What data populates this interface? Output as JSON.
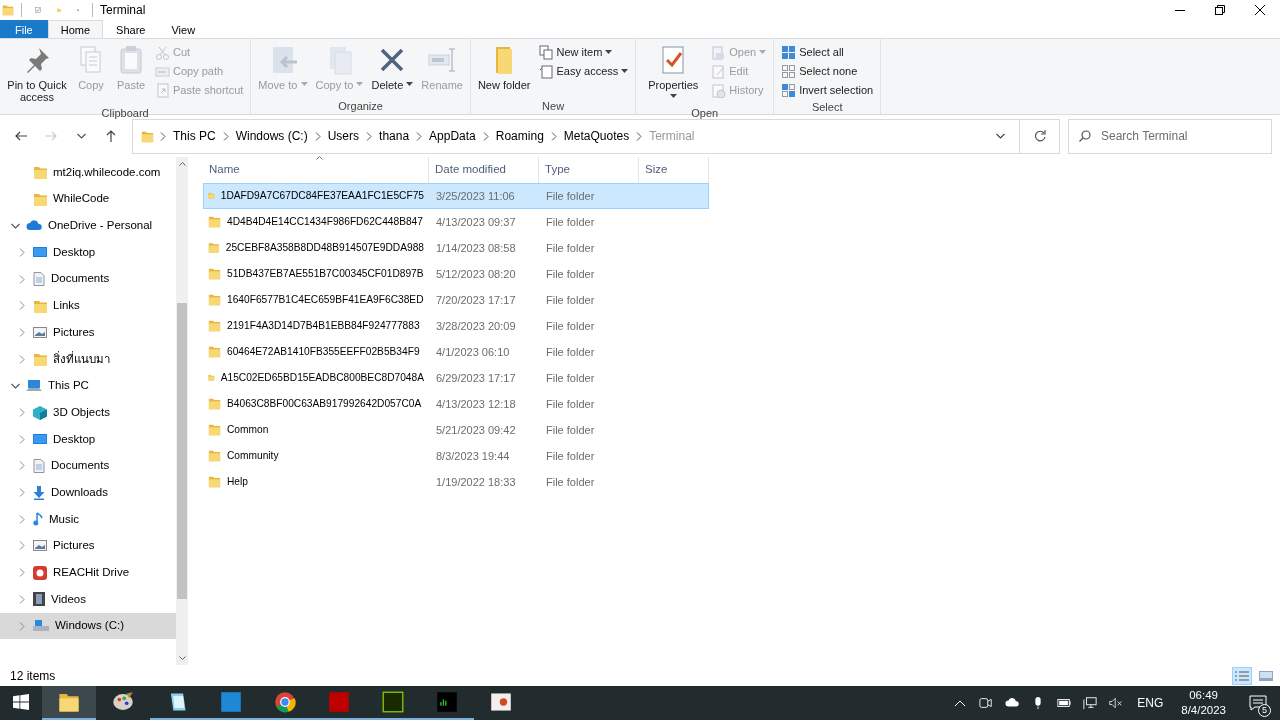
{
  "window": {
    "title": "Terminal"
  },
  "ribbon_tabs": [
    {
      "label": "File",
      "kind": "file",
      "selected": false
    },
    {
      "label": "Home",
      "kind": "tab",
      "selected": true
    },
    {
      "label": "Share",
      "kind": "tab",
      "selected": false
    },
    {
      "label": "View",
      "kind": "tab",
      "selected": false
    }
  ],
  "ribbon_groups": [
    {
      "label": "Clipboard",
      "commands": [
        {
          "label": "Pin to Quick access",
          "kind": "large",
          "disabled": false,
          "dropdown": false
        },
        {
          "label": "Copy",
          "kind": "large",
          "disabled": true,
          "dropdown": false
        },
        {
          "label": "Paste",
          "kind": "large",
          "disabled": true,
          "dropdown": false
        },
        {
          "label": "Cut",
          "kind": "small",
          "disabled": true,
          "dropdown": false
        },
        {
          "label": "Copy path",
          "kind": "small",
          "disabled": true,
          "dropdown": false
        },
        {
          "label": "Paste shortcut",
          "kind": "small",
          "disabled": true,
          "dropdown": false
        }
      ]
    },
    {
      "label": "Organize",
      "commands": [
        {
          "label": "Move to",
          "kind": "large",
          "disabled": true,
          "dropdown": true
        },
        {
          "label": "Copy to",
          "kind": "large",
          "disabled": true,
          "dropdown": true
        },
        {
          "label": "Delete",
          "kind": "large",
          "disabled": false,
          "dropdown": true
        },
        {
          "label": "Rename",
          "kind": "large",
          "disabled": true,
          "dropdown": false
        }
      ]
    },
    {
      "label": "New",
      "commands": [
        {
          "label": "New folder",
          "kind": "large",
          "disabled": false,
          "dropdown": false
        },
        {
          "label": "New item",
          "kind": "small",
          "disabled": false,
          "dropdown": true
        },
        {
          "label": "Easy access",
          "kind": "small",
          "disabled": false,
          "dropdown": true
        }
      ]
    },
    {
      "label": "Open",
      "commands": [
        {
          "label": "Properties",
          "kind": "large",
          "disabled": false,
          "dropdown": true
        },
        {
          "label": "Open",
          "kind": "small",
          "disabled": true,
          "dropdown": true
        },
        {
          "label": "Edit",
          "kind": "small",
          "disabled": true,
          "dropdown": false
        },
        {
          "label": "History",
          "kind": "small",
          "disabled": true,
          "dropdown": false
        }
      ]
    },
    {
      "label": "Select",
      "commands": [
        {
          "label": "Select all",
          "kind": "small",
          "disabled": false,
          "dropdown": false
        },
        {
          "label": "Select none",
          "kind": "small",
          "disabled": false,
          "dropdown": false
        },
        {
          "label": "Invert selection",
          "kind": "small",
          "disabled": false,
          "dropdown": false
        }
      ]
    }
  ],
  "navigation": {
    "back_disabled": false,
    "forward_disabled": true,
    "up_disabled": false
  },
  "address": {
    "crumbs": [
      "This PC",
      "Windows (C:)",
      "Users",
      "thana",
      "AppData",
      "Roaming",
      "MetaQuotes",
      "Terminal"
    ],
    "search_placeholder": "Search Terminal"
  },
  "nav_pane": {
    "continued_items": [
      {
        "label": "mt2iq.whilecode.com",
        "selected": false
      },
      {
        "label": "WhileCode",
        "selected": false
      }
    ],
    "roots": [
      {
        "label": "OneDrive - Personal",
        "expanded": true,
        "selected": false,
        "children": [
          {
            "label": "Desktop",
            "expanded": false,
            "selected": false
          },
          {
            "label": "Documents",
            "expanded": false,
            "selected": false
          },
          {
            "label": "Links",
            "expanded": false,
            "selected": false
          },
          {
            "label": "Pictures",
            "expanded": false,
            "selected": false
          },
          {
            "label": "สิ่งที่แนบมา",
            "expanded": false,
            "selected": false
          }
        ]
      },
      {
        "label": "This PC",
        "expanded": true,
        "selected": false,
        "children": [
          {
            "label": "3D Objects",
            "expanded": false,
            "selected": false
          },
          {
            "label": "Desktop",
            "expanded": false,
            "selected": false
          },
          {
            "label": "Documents",
            "expanded": false,
            "selected": false
          },
          {
            "label": "Downloads",
            "expanded": false,
            "selected": false
          },
          {
            "label": "Music",
            "expanded": false,
            "selected": false
          },
          {
            "label": "Pictures",
            "expanded": false,
            "selected": false
          },
          {
            "label": "REACHit Drive",
            "expanded": false,
            "selected": false
          },
          {
            "label": "Videos",
            "expanded": false,
            "selected": false
          },
          {
            "label": "Windows (C:)",
            "expanded": false,
            "selected": true
          }
        ]
      }
    ]
  },
  "table": {
    "columns": [
      {
        "label": "Name",
        "sorted": true
      },
      {
        "label": "Date modified",
        "sorted": false
      },
      {
        "label": "Type",
        "sorted": false
      },
      {
        "label": "Size",
        "sorted": false
      }
    ],
    "rows": [
      {
        "name": "1DAFD9A7C67DC84FE37EAA1FC1E5CF75",
        "date": "3/25/2023 11:06",
        "type": "File folder",
        "selected": true
      },
      {
        "name": "4D4B4D4E14CC1434F986FD62C448B847",
        "date": "4/13/2023 09:37",
        "type": "File folder",
        "selected": false
      },
      {
        "name": "25CEBF8A358B8DD48B914507E9DDA988",
        "date": "1/14/2023 08:58",
        "type": "File folder",
        "selected": false
      },
      {
        "name": "51DB437EB7AE551B7C00345CF01D897B",
        "date": "5/12/2023 08:20",
        "type": "File folder",
        "selected": false
      },
      {
        "name": "1640F6577B1C4EC659BF41EA9F6C38ED",
        "date": "7/20/2023 17:17",
        "type": "File folder",
        "selected": false
      },
      {
        "name": "2191F4A3D14D7B4B1EBB84F924777883",
        "date": "3/28/2023 20:09",
        "type": "File folder",
        "selected": false
      },
      {
        "name": "60464E72AB1410FB355EEFF02B5B34F9",
        "date": "4/1/2023 06:10",
        "type": "File folder",
        "selected": false
      },
      {
        "name": "A15C02ED65BD15EADBC800BEC8D7048A",
        "date": "6/29/2023 17:17",
        "type": "File folder",
        "selected": false
      },
      {
        "name": "B4063C8BF00C63AB917992642D057C0A",
        "date": "4/13/2023 12:18",
        "type": "File folder",
        "selected": false
      },
      {
        "name": "Common",
        "date": "5/21/2023 09:42",
        "type": "File folder",
        "selected": false
      },
      {
        "name": "Community",
        "date": "8/3/2023 19:44",
        "type": "File folder",
        "selected": false
      },
      {
        "name": "Help",
        "date": "1/19/2022 18:33",
        "type": "File folder",
        "selected": false
      }
    ]
  },
  "status_bar": {
    "item_count": "12 items",
    "views": [
      {
        "selected": true
      },
      {
        "selected": false
      }
    ]
  },
  "taskbar": {
    "apps": [
      {
        "active": true,
        "running": true
      },
      {
        "active": false,
        "running": false
      },
      {
        "active": false,
        "running": true
      },
      {
        "active": false,
        "running": true
      },
      {
        "active": false,
        "running": true
      },
      {
        "active": false,
        "running": true
      },
      {
        "active": false,
        "running": true
      },
      {
        "active": false,
        "running": true
      },
      {
        "active": false,
        "running": false
      }
    ],
    "tray": {
      "volume_muted": true,
      "language": "ENG",
      "time": "06:49",
      "date": "8/4/2023",
      "notification_count": "5"
    }
  }
}
